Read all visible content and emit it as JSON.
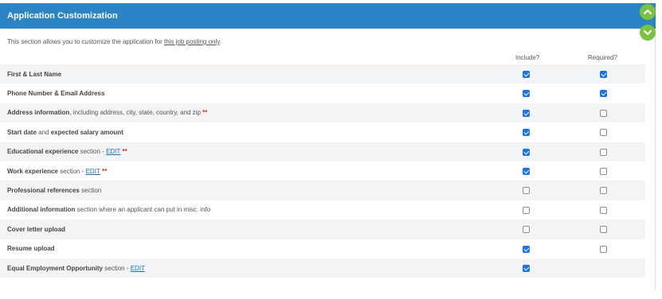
{
  "header": {
    "title": "Application Customization"
  },
  "intro": {
    "text": "This section allows you to customize the application for ",
    "link": "this job posting only",
    "suffix": "."
  },
  "columns": {
    "include": "Include?",
    "required": "Required?"
  },
  "rows": [
    {
      "bold": "First & Last Name",
      "rest": "",
      "edit": "",
      "star": "",
      "include": true,
      "required": true
    },
    {
      "bold": "Phone Number & Email Address",
      "rest": "",
      "edit": "",
      "star": "",
      "include": true,
      "required": true
    },
    {
      "bold": "Address information",
      "rest": ", including address, city, state, country, and zip ",
      "edit": "",
      "star": "**",
      "include": true,
      "required": false
    },
    {
      "bold": "Start date",
      "rest": " and ",
      "bold2": "expected salary amount",
      "edit": "",
      "star": "",
      "include": true,
      "required": false
    },
    {
      "bold": "Educational experience",
      "rest": " section - ",
      "edit": "EDIT",
      "star": " **",
      "include": true,
      "required": false
    },
    {
      "bold": "Work experience",
      "rest": " section - ",
      "edit": "EDIT",
      "star": " **",
      "include": true,
      "required": false
    },
    {
      "bold": "Professional references",
      "rest": " section",
      "edit": "",
      "star": "",
      "include": false,
      "required": false
    },
    {
      "bold": "Additional information",
      "rest": " section where an applicant can put in misc. info",
      "edit": "",
      "star": "",
      "include": false,
      "required": false
    },
    {
      "bold": "Cover letter upload",
      "rest": "",
      "edit": "",
      "star": "",
      "include": false,
      "required": false
    },
    {
      "bold": "Resume upload",
      "rest": "",
      "edit": "",
      "star": "",
      "include": true,
      "required": false
    },
    {
      "bold": "Equal Employment Opportunity",
      "rest": " section - ",
      "edit": "EDIT",
      "star": "",
      "include": true,
      "required": null
    }
  ],
  "colors": {
    "header": "#2a84c6",
    "accent": "#7cc242",
    "checkbox": "#1a73e8",
    "link": "#1a6fc4",
    "required_star": "#e02222"
  },
  "icons": {
    "scroll_up": "chevron-up-icon",
    "scroll_down": "chevron-down-icon"
  }
}
